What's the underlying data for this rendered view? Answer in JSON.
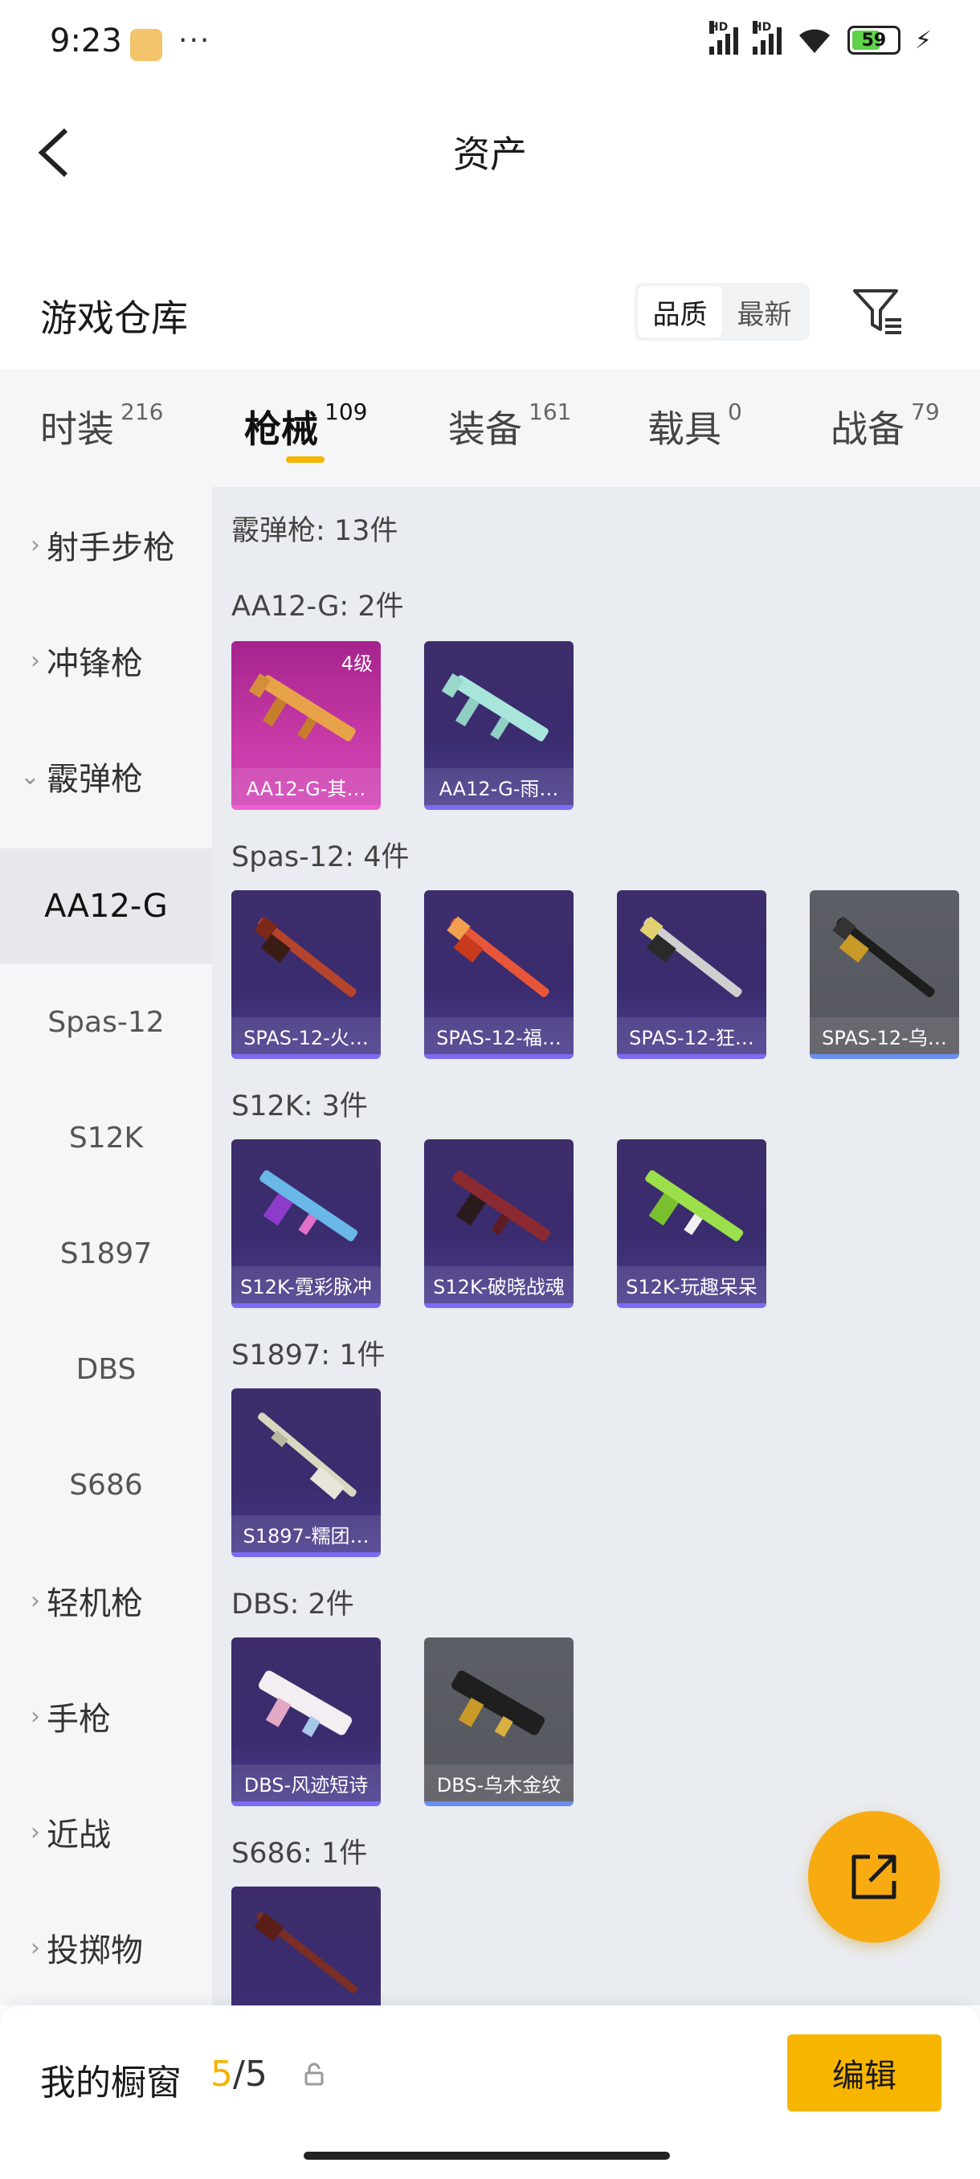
{
  "status_bar": {
    "time": "9:23",
    "more": "···",
    "battery": "59"
  },
  "header": {
    "title": "资产"
  },
  "warehouse": {
    "title": "游戏仓库",
    "sort_options": [
      "品质",
      "最新"
    ]
  },
  "tabs": [
    {
      "label": "时装",
      "count": "216"
    },
    {
      "label": "枪械",
      "count": "109"
    },
    {
      "label": "装备",
      "count": "161"
    },
    {
      "label": "载具",
      "count": "0"
    },
    {
      "label": "战备",
      "count": "79"
    }
  ],
  "sidebar": {
    "cat_rifle": "射手步枪",
    "cat_smg": "冲锋枪",
    "cat_shotgun": "霰弹枪",
    "subs": [
      "AA12-G",
      "Spas-12",
      "S12K",
      "S1897",
      "DBS",
      "S686"
    ],
    "cat_lmg": "轻机枪",
    "cat_pistol": "手枪",
    "cat_melee": "近战",
    "cat_throw": "投掷物"
  },
  "content": {
    "summary": "霰弹枪: 13件",
    "groups": [
      {
        "title": "AA12-G: 2件",
        "items": [
          {
            "name": "AA12-G-其…",
            "level": "4级"
          },
          {
            "name": "AA12-G-雨…"
          }
        ]
      },
      {
        "title": "Spas-12: 4件",
        "items": [
          {
            "name": "SPAS-12-火…"
          },
          {
            "name": "SPAS-12-福…"
          },
          {
            "name": "SPAS-12-狂…"
          },
          {
            "name": "SPAS-12-乌…"
          }
        ]
      },
      {
        "title": "S12K: 3件",
        "items": [
          {
            "name": "S12K-霓彩脉冲"
          },
          {
            "name": "S12K-破晓战魂"
          },
          {
            "name": "S12K-玩趣呆呆"
          }
        ]
      },
      {
        "title": "S1897: 1件",
        "items": [
          {
            "name": "S1897-糯团…"
          }
        ]
      },
      {
        "title": "DBS: 2件",
        "items": [
          {
            "name": "DBS-风迹短诗"
          },
          {
            "name": "DBS-乌木金纹"
          }
        ]
      },
      {
        "title": "S686: 1件",
        "items": []
      }
    ]
  },
  "bottom": {
    "label": "我的橱窗",
    "count_current": "5",
    "count_sep": "/5",
    "edit": "编辑"
  },
  "colors": {
    "accent": "#f5b400",
    "card_purple": "#3d2d6b",
    "card_pink": "#c73aa6",
    "card_gray": "#5d5f66"
  }
}
